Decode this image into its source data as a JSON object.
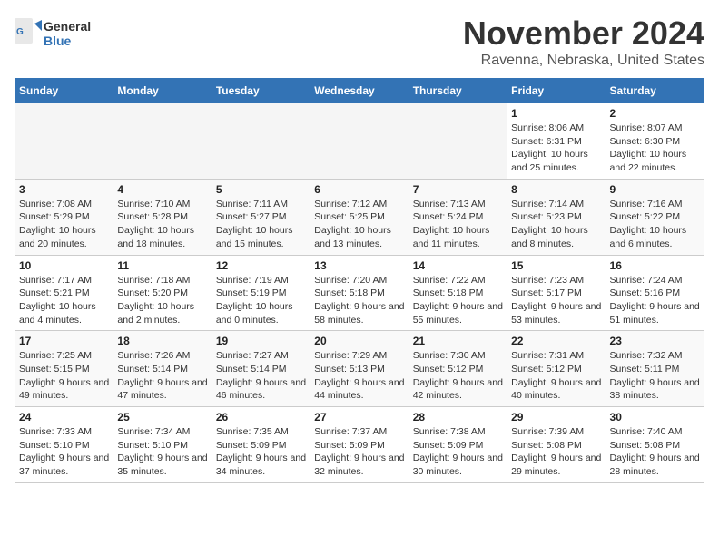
{
  "header": {
    "logo_general": "General",
    "logo_blue": "Blue",
    "month_title": "November 2024",
    "location": "Ravenna, Nebraska, United States"
  },
  "calendar": {
    "headers": [
      "Sunday",
      "Monday",
      "Tuesday",
      "Wednesday",
      "Thursday",
      "Friday",
      "Saturday"
    ],
    "weeks": [
      [
        {
          "day": "",
          "info": ""
        },
        {
          "day": "",
          "info": ""
        },
        {
          "day": "",
          "info": ""
        },
        {
          "day": "",
          "info": ""
        },
        {
          "day": "",
          "info": ""
        },
        {
          "day": "1",
          "info": "Sunrise: 8:06 AM\nSunset: 6:31 PM\nDaylight: 10 hours and 25 minutes."
        },
        {
          "day": "2",
          "info": "Sunrise: 8:07 AM\nSunset: 6:30 PM\nDaylight: 10 hours and 22 minutes."
        }
      ],
      [
        {
          "day": "3",
          "info": "Sunrise: 7:08 AM\nSunset: 5:29 PM\nDaylight: 10 hours and 20 minutes."
        },
        {
          "day": "4",
          "info": "Sunrise: 7:10 AM\nSunset: 5:28 PM\nDaylight: 10 hours and 18 minutes."
        },
        {
          "day": "5",
          "info": "Sunrise: 7:11 AM\nSunset: 5:27 PM\nDaylight: 10 hours and 15 minutes."
        },
        {
          "day": "6",
          "info": "Sunrise: 7:12 AM\nSunset: 5:25 PM\nDaylight: 10 hours and 13 minutes."
        },
        {
          "day": "7",
          "info": "Sunrise: 7:13 AM\nSunset: 5:24 PM\nDaylight: 10 hours and 11 minutes."
        },
        {
          "day": "8",
          "info": "Sunrise: 7:14 AM\nSunset: 5:23 PM\nDaylight: 10 hours and 8 minutes."
        },
        {
          "day": "9",
          "info": "Sunrise: 7:16 AM\nSunset: 5:22 PM\nDaylight: 10 hours and 6 minutes."
        }
      ],
      [
        {
          "day": "10",
          "info": "Sunrise: 7:17 AM\nSunset: 5:21 PM\nDaylight: 10 hours and 4 minutes."
        },
        {
          "day": "11",
          "info": "Sunrise: 7:18 AM\nSunset: 5:20 PM\nDaylight: 10 hours and 2 minutes."
        },
        {
          "day": "12",
          "info": "Sunrise: 7:19 AM\nSunset: 5:19 PM\nDaylight: 10 hours and 0 minutes."
        },
        {
          "day": "13",
          "info": "Sunrise: 7:20 AM\nSunset: 5:18 PM\nDaylight: 9 hours and 58 minutes."
        },
        {
          "day": "14",
          "info": "Sunrise: 7:22 AM\nSunset: 5:18 PM\nDaylight: 9 hours and 55 minutes."
        },
        {
          "day": "15",
          "info": "Sunrise: 7:23 AM\nSunset: 5:17 PM\nDaylight: 9 hours and 53 minutes."
        },
        {
          "day": "16",
          "info": "Sunrise: 7:24 AM\nSunset: 5:16 PM\nDaylight: 9 hours and 51 minutes."
        }
      ],
      [
        {
          "day": "17",
          "info": "Sunrise: 7:25 AM\nSunset: 5:15 PM\nDaylight: 9 hours and 49 minutes."
        },
        {
          "day": "18",
          "info": "Sunrise: 7:26 AM\nSunset: 5:14 PM\nDaylight: 9 hours and 47 minutes."
        },
        {
          "day": "19",
          "info": "Sunrise: 7:27 AM\nSunset: 5:14 PM\nDaylight: 9 hours and 46 minutes."
        },
        {
          "day": "20",
          "info": "Sunrise: 7:29 AM\nSunset: 5:13 PM\nDaylight: 9 hours and 44 minutes."
        },
        {
          "day": "21",
          "info": "Sunrise: 7:30 AM\nSunset: 5:12 PM\nDaylight: 9 hours and 42 minutes."
        },
        {
          "day": "22",
          "info": "Sunrise: 7:31 AM\nSunset: 5:12 PM\nDaylight: 9 hours and 40 minutes."
        },
        {
          "day": "23",
          "info": "Sunrise: 7:32 AM\nSunset: 5:11 PM\nDaylight: 9 hours and 38 minutes."
        }
      ],
      [
        {
          "day": "24",
          "info": "Sunrise: 7:33 AM\nSunset: 5:10 PM\nDaylight: 9 hours and 37 minutes."
        },
        {
          "day": "25",
          "info": "Sunrise: 7:34 AM\nSunset: 5:10 PM\nDaylight: 9 hours and 35 minutes."
        },
        {
          "day": "26",
          "info": "Sunrise: 7:35 AM\nSunset: 5:09 PM\nDaylight: 9 hours and 34 minutes."
        },
        {
          "day": "27",
          "info": "Sunrise: 7:37 AM\nSunset: 5:09 PM\nDaylight: 9 hours and 32 minutes."
        },
        {
          "day": "28",
          "info": "Sunrise: 7:38 AM\nSunset: 5:09 PM\nDaylight: 9 hours and 30 minutes."
        },
        {
          "day": "29",
          "info": "Sunrise: 7:39 AM\nSunset: 5:08 PM\nDaylight: 9 hours and 29 minutes."
        },
        {
          "day": "30",
          "info": "Sunrise: 7:40 AM\nSunset: 5:08 PM\nDaylight: 9 hours and 28 minutes."
        }
      ]
    ]
  }
}
